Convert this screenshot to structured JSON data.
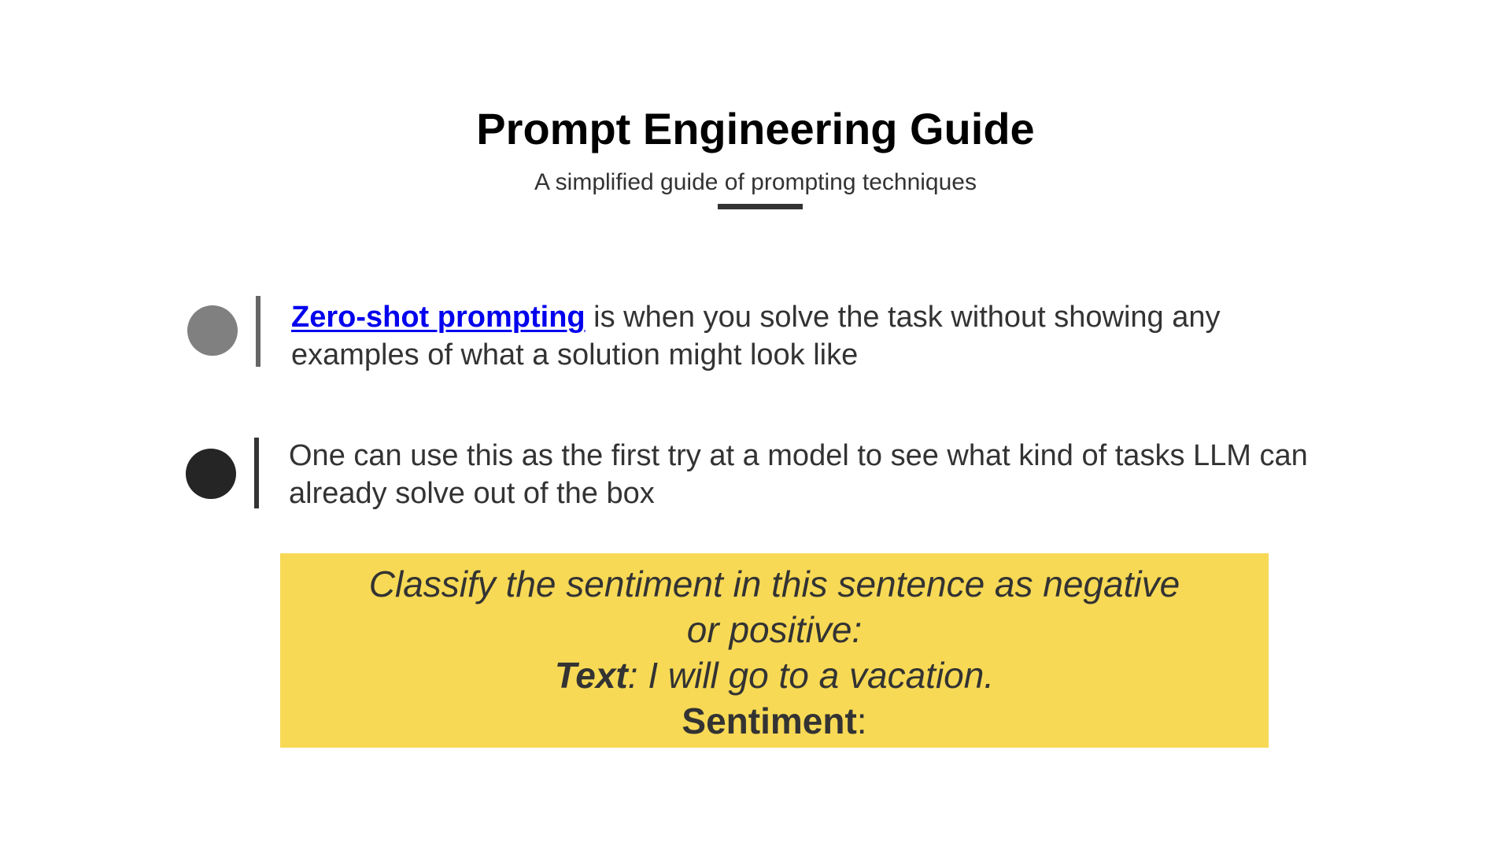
{
  "header": {
    "title": "Prompt Engineering Guide",
    "subtitle": "A simplified guide of prompting techniques"
  },
  "bullets": [
    {
      "link_text": "Zero-shot prompting",
      "text": " is when you solve the task without showing any examples of what a solution might look like"
    },
    {
      "text": "One can use this as the first try at a model to see what kind of tasks LLM can already solve out of the box"
    }
  ],
  "example_prompt": {
    "line1": "Classify the sentiment in this sentence as negative",
    "line2": "or positive:",
    "text_label": "Text",
    "text_value": ": I will go to a vacation.",
    "sentiment_label": "Sentiment",
    "sentiment_value": ":"
  },
  "colors": {
    "background": "#ffffff",
    "link": "#0000ee",
    "prompt_box": "#f7d955",
    "bullet_dot_1": "#808080",
    "bullet_dot_2": "#252525",
    "text": "#333333"
  }
}
